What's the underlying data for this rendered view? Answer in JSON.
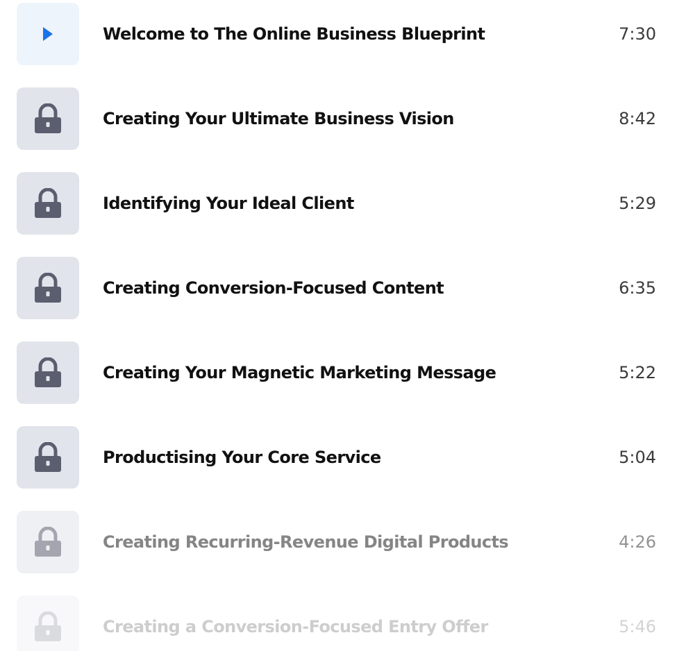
{
  "lessons": [
    {
      "title": "Welcome to The Online Business Blueprint",
      "duration": "7:30",
      "icon": "play-icon",
      "locked": false
    },
    {
      "title": "Creating Your Ultimate Business Vision",
      "duration": "8:42",
      "icon": "lock-icon",
      "locked": true
    },
    {
      "title": "Identifying Your Ideal Client",
      "duration": "5:29",
      "icon": "lock-icon",
      "locked": true
    },
    {
      "title": "Creating Conversion-Focused Content",
      "duration": "6:35",
      "icon": "lock-icon",
      "locked": true
    },
    {
      "title": "Creating Your Magnetic Marketing Message",
      "duration": "5:22",
      "icon": "lock-icon",
      "locked": true
    },
    {
      "title": "Productising Your Core Service",
      "duration": "5:04",
      "icon": "lock-icon",
      "locked": true
    },
    {
      "title": "Creating Recurring-Revenue Digital Products",
      "duration": "4:26",
      "icon": "lock-icon",
      "locked": true
    },
    {
      "title": "Creating a Conversion-Focused Entry Offer",
      "duration": "5:46",
      "icon": "lock-icon",
      "locked": true
    }
  ],
  "colors": {
    "play_accent": "#1a73e8",
    "lock_fill": "#5b5e6e",
    "icon_box_bg": "#e2e4ec",
    "active_icon_box_bg": "#eef4fb"
  }
}
